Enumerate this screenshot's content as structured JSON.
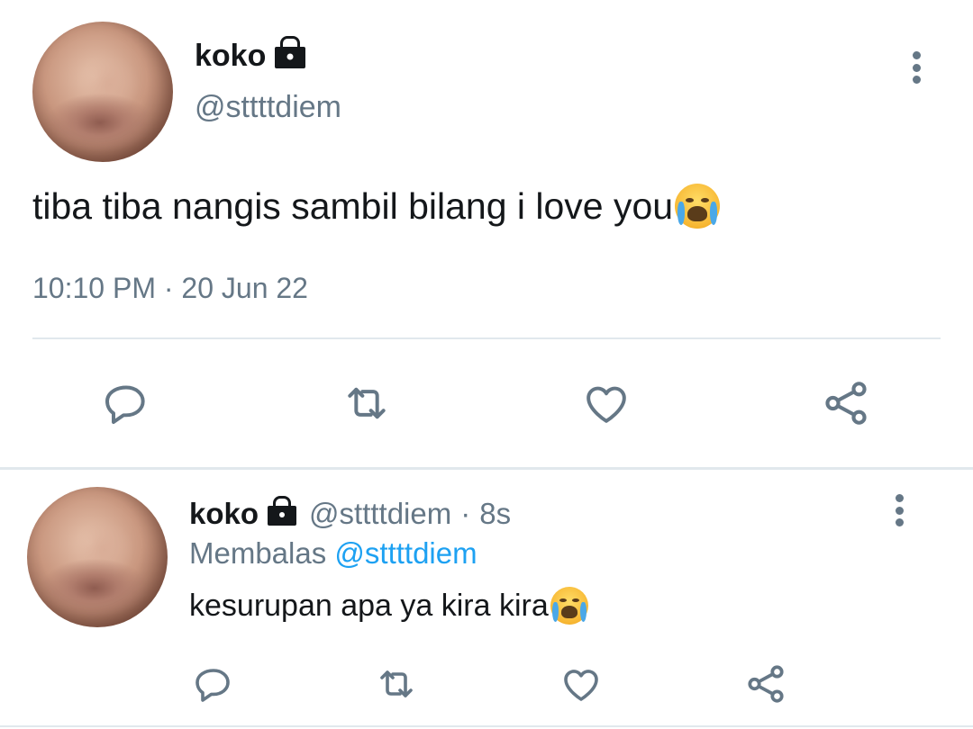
{
  "tweet": {
    "display_name": "koko",
    "handle": "@sttttdiem",
    "text": "tiba tiba nangis sambil bilang i love you",
    "emoji": "loudly-crying-face",
    "time": "10:10 PM",
    "separator": "·",
    "date": "20 Jun 22",
    "protected": true
  },
  "reply": {
    "display_name": "koko",
    "handle": "@sttttdiem",
    "separator": "·",
    "age": "8s",
    "replying_label": "Membalas",
    "replying_to": "@sttttdiem",
    "text": "kesurupan apa ya kira kira",
    "emoji": "loudly-crying-face",
    "protected": true
  },
  "actions": [
    "reply-icon",
    "retweet-icon",
    "like-icon",
    "share-icon"
  ],
  "colors": {
    "text": "#14171a",
    "muted": "#657786",
    "link": "#1da1f2",
    "divider": "#e1e8ed",
    "background": "#ffffff"
  }
}
